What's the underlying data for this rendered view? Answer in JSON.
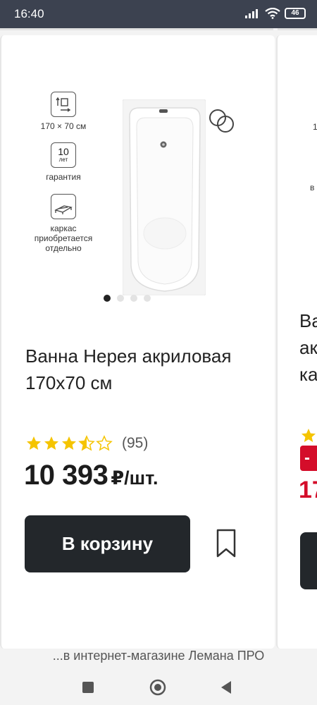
{
  "status_bar": {
    "time": "16:40",
    "battery": "46"
  },
  "product": {
    "features": [
      {
        "label": "170 × 70 см",
        "icon": "dimensions-icon"
      },
      {
        "number": "10",
        "unit": "лет",
        "label": "гарантия",
        "icon": "warranty-icon"
      },
      {
        "label": "каркас приобретается отдельно",
        "icon": "frame-icon"
      }
    ],
    "gallery": {
      "total": 4,
      "active": 1
    },
    "title": "Ванна Нерея акриловая 170x70 см",
    "rating": {
      "value": 3.5,
      "max": 5,
      "reviews": "(95)"
    },
    "price": {
      "amount": "10 393",
      "unit": "₽/шт."
    },
    "cart_button": "В корзину"
  },
  "next_product": {
    "feature_1": "1",
    "feature_2": "в",
    "title_lines": [
      "Ва",
      "ак",
      "ка"
    ],
    "discount": "-",
    "price": "17"
  },
  "footer": "...в интернет-магазине Лемана ПРО",
  "colors": {
    "status_bar": "#3c4250",
    "button": "#23272b",
    "star": "#f5c400",
    "sale": "#d40d2a"
  }
}
